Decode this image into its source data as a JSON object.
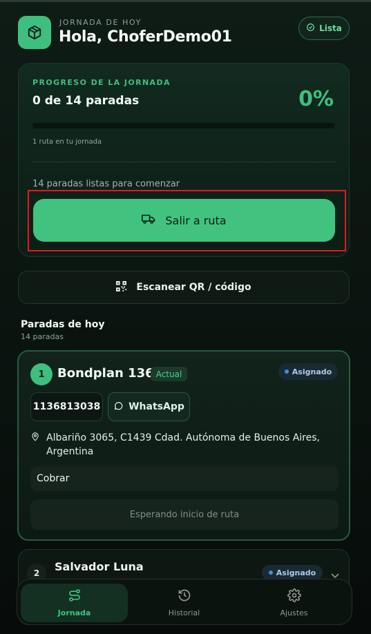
{
  "header": {
    "eyebrow": "JORNADA DE HOY",
    "greeting": "Hola, ChoferDemo01",
    "status_label": "Lista",
    "icons": {
      "app": "box-icon",
      "status": "check-circle-icon"
    }
  },
  "progress": {
    "label": "PROGRESO DE LA JORNADA",
    "count_text": "0 de 14 paradas",
    "percent_text": "0%",
    "progress_fraction": 0,
    "routes_text": "1 ruta en tu jornada",
    "ready_text": "14 paradas listas para comenzar",
    "go_label": "Salir a ruta",
    "go_icon": "truck-icon"
  },
  "scan": {
    "label": "Escanear QR / código",
    "icon": "qr-code-icon"
  },
  "stops_section": {
    "title": "Paradas de hoy",
    "subtitle": "14 paradas"
  },
  "stops": [
    {
      "number": "1",
      "name": "Bondplan 1367",
      "current_badge": "Actual",
      "status": "Asignado",
      "phone": "1136813038",
      "whatsapp_label": "WhatsApp",
      "address": "Albariño 3065, C1439 Cdad. Autónoma de Buenos Aires, Argentina",
      "collect_label": "Cobrar",
      "waiting_text": "Esperando inicio de ruta"
    },
    {
      "number": "2",
      "name": "Salvador Luna",
      "status": "Asignado"
    }
  ],
  "nav": {
    "items": [
      {
        "label": "Jornada",
        "icon": "route-icon",
        "active": true
      },
      {
        "label": "Historial",
        "icon": "history-icon",
        "active": false
      },
      {
        "label": "Ajustes",
        "icon": "gear-icon",
        "active": false
      }
    ]
  },
  "colors": {
    "accent": "#41c37f",
    "background": "#0b1510",
    "status_blue": "#3b8ff0",
    "highlight": "#e01b1b"
  }
}
